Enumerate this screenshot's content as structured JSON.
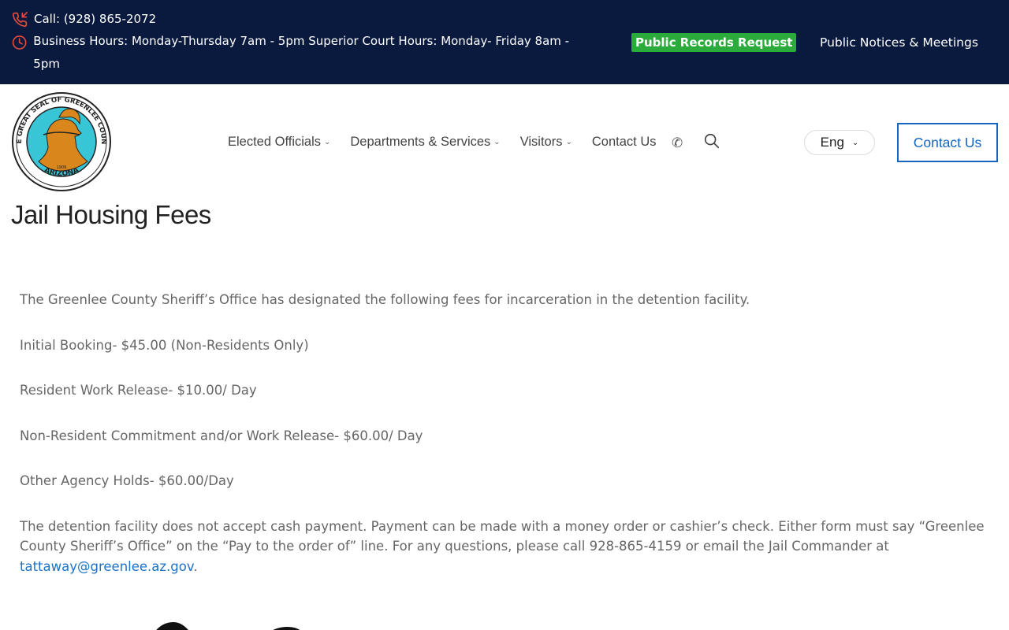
{
  "topbar": {
    "call": "Call: (928) 865-2072",
    "hours": "Business Hours: Monday-Thursday 7am - 5pm Superior Court Hours: Monday- Friday 8am - 5pm",
    "public_records": "Public Records Request",
    "public_notices": "Public Notices & Meetings"
  },
  "colors": {
    "topbar_bg": "#0a1a3f",
    "accent_green": "#2bab3b",
    "accent_blue": "#1565c0",
    "icon_red": "#e34b3b"
  },
  "logo": {
    "seal_text": "THE GREAT SEAL OF GREENLEE COUNTY",
    "state": "ARIZONA",
    "year": "1909"
  },
  "nav": {
    "items": [
      {
        "label": "Elected Officials",
        "dropdown": true
      },
      {
        "label": "Departments & Services",
        "dropdown": true
      },
      {
        "label": "Visitors",
        "dropdown": true
      },
      {
        "label": "Contact Us",
        "dropdown": false
      }
    ],
    "phone_icon": "phone-icon",
    "search_icon": "search-icon"
  },
  "language": {
    "selected": "Eng"
  },
  "contact_button": "Contact Us",
  "page": {
    "title": "Jail Housing Fees",
    "intro": "The Greenlee County Sheriff’s Office has designated the following fees for incarceration in the detention facility.",
    "fees": [
      "Initial Booking- $45.00 (Non-Residents Only)",
      "Resident Work Release- $10.00/ Day",
      "Non-Resident Commitment and/or Work Release- $60.00/ Day",
      "Other Agency Holds- $60.00/Day"
    ],
    "payment_text": "The detention facility does not accept cash payment. Payment can be made with a money order or cashier’s check. Either form must say “Greenlee County Sheriff’s Office” on the “Pay to the order of” line. For any questions, please call 928-865-4159 or email the Jail Commander at ",
    "email": "tattaway@greenlee.az.gov",
    "period": "."
  }
}
